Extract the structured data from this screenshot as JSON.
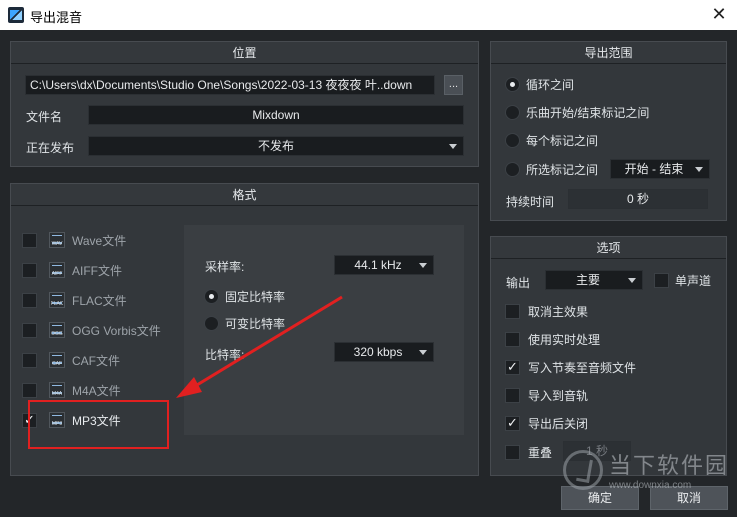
{
  "window": {
    "title": "导出混音",
    "close_glyph": "✕"
  },
  "location": {
    "header": "位置",
    "path": "C:\\Users\\dx\\Documents\\Studio One\\Songs\\2022-03-13 夜夜夜 叶..down",
    "browse_label": "...",
    "filename_label": "文件名",
    "filename_value": "Mixdown",
    "publish_label": "正在发布",
    "publish_value": "不发布"
  },
  "format": {
    "header": "格式",
    "items": [
      {
        "label": "Wave文件",
        "tag": "WAV",
        "checked": false
      },
      {
        "label": "AIFF文件",
        "tag": "AIFF",
        "checked": false
      },
      {
        "label": "FLAC文件",
        "tag": "FLAC",
        "checked": false
      },
      {
        "label": "OGG Vorbis文件",
        "tag": "OGG",
        "checked": false
      },
      {
        "label": "CAF文件",
        "tag": "CAF",
        "checked": false
      },
      {
        "label": "M4A文件",
        "tag": "M4A",
        "checked": false
      },
      {
        "label": "MP3文件",
        "tag": "MP3",
        "checked": true
      }
    ],
    "sample_rate_label": "采样率:",
    "sample_rate_value": "44.1 kHz",
    "fixed_bitrate_label": "固定比特率",
    "variable_bitrate_label": "可变比特率",
    "bitrate_label": "比特率:",
    "bitrate_value": "320 kbps"
  },
  "range": {
    "header": "导出范围",
    "options": [
      "循环之间",
      "乐曲开始/结束标记之间",
      "每个标记之间",
      "所选标记之间"
    ],
    "selected_index": 0,
    "marker_select_value": "开始 - 结束",
    "duration_label": "持续时间",
    "duration_value": "0 秒"
  },
  "options": {
    "header": "选项",
    "output_label": "输出",
    "output_value": "主要",
    "mono_label": "单声道",
    "items": [
      {
        "label": "取消主效果",
        "checked": false
      },
      {
        "label": "使用实时处理",
        "checked": false
      },
      {
        "label": "写入节奏至音频文件",
        "checked": true
      },
      {
        "label": "导入到音轨",
        "checked": false
      },
      {
        "label": "导出后关闭",
        "checked": true
      }
    ],
    "repeat_label": "重叠",
    "repeat_value": "1 秒"
  },
  "buttons": {
    "ok": "确定",
    "cancel": "取消"
  },
  "watermark": {
    "text": "当下软件园",
    "url": "www.downxia.com"
  },
  "colors": {
    "annotation": "#e12020",
    "background": "#232629",
    "panel": "#33373b"
  }
}
